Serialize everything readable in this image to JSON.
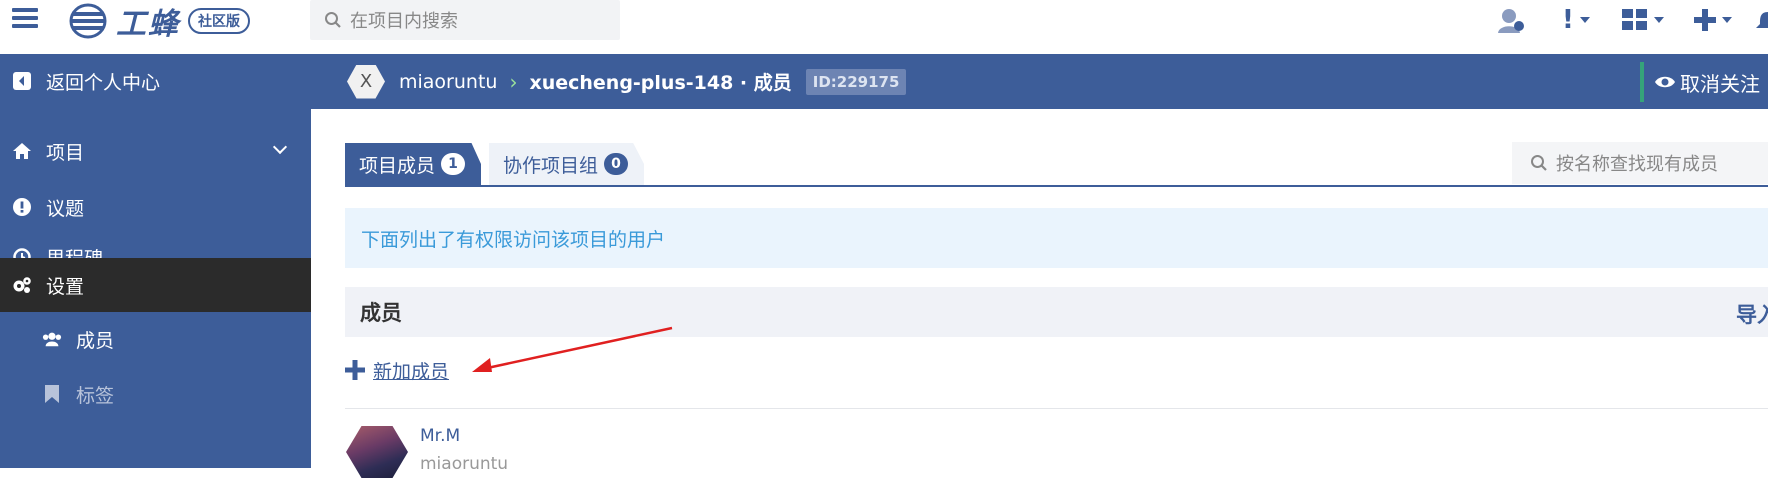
{
  "topbar": {
    "brand": "工蜂",
    "edition_badge": "社区版",
    "search_placeholder": "在项目内搜索"
  },
  "sidebar": {
    "back": "返回个人中心",
    "items": [
      {
        "label": "项目",
        "icon": "home-icon"
      },
      {
        "label": "议题",
        "icon": "alert-icon"
      },
      {
        "label": "里程碑",
        "icon": "clock-icon"
      },
      {
        "label": "设置",
        "icon": "gears-icon",
        "active": true
      },
      {
        "label": "成员",
        "icon": "users-icon",
        "sub": true
      },
      {
        "label": "标签",
        "icon": "bookmark-icon",
        "sub": true
      }
    ]
  },
  "breadcrumb": {
    "avatar_letter": "X",
    "user": "miaoruntu",
    "separator": "›",
    "project": "xuecheng-plus-148 · 成员",
    "id_badge": "ID:229175",
    "unfollow": "取消关注"
  },
  "tabs": [
    {
      "label": "项目成员",
      "count": "1"
    },
    {
      "label": "协作项目组",
      "count": "0"
    }
  ],
  "member_search_placeholder": "按名称查找现有成员",
  "info_text": "下面列出了有权限访问该项目的用户",
  "members": {
    "heading": "成员",
    "import": "导入",
    "add": "新加成员",
    "list": [
      {
        "name": "Mr.M",
        "username": "miaoruntu"
      }
    ]
  },
  "colors": {
    "primary": "#3d5d99",
    "annotation": "#e02020",
    "info_text": "#3a9ad9"
  }
}
